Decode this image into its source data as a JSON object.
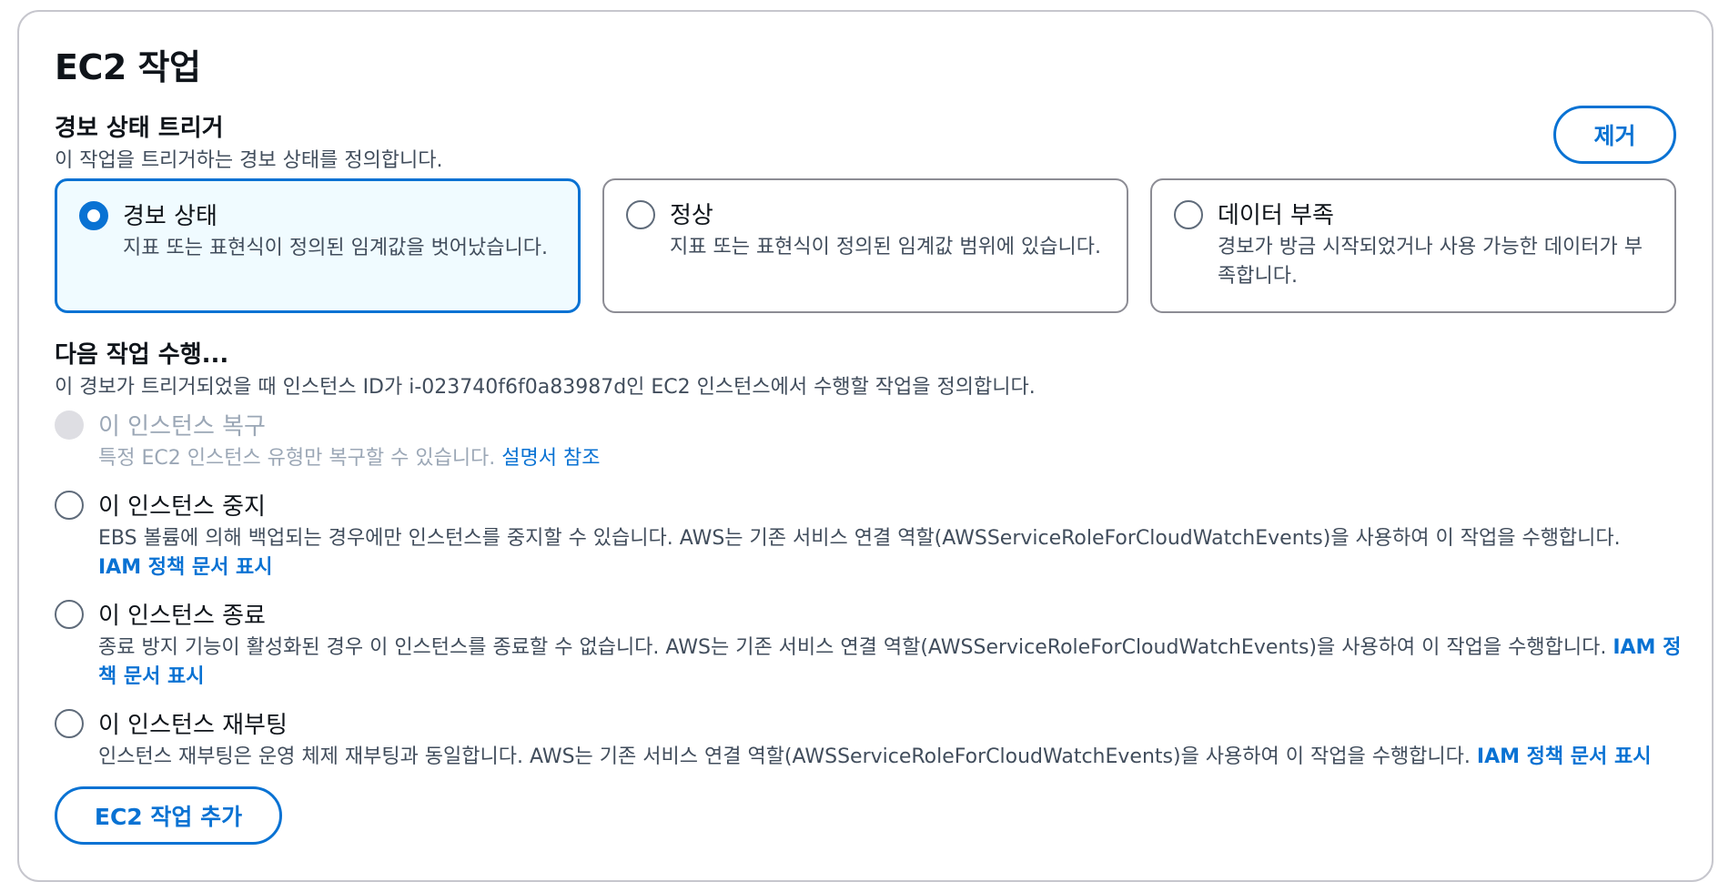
{
  "header": {
    "title": "EC2 작업"
  },
  "remove_button": "제거",
  "trigger": {
    "title": "경보 상태 트리거",
    "description": "이 작업을 트리거하는 경보 상태를 정의합니다.",
    "tiles": [
      {
        "label": "경보 상태",
        "description": "지표 또는 표현식이 정의된 임계값을 벗어났습니다.",
        "selected": true
      },
      {
        "label": "정상",
        "description": "지표 또는 표현식이 정의된 임계값 범위에 있습니다.",
        "selected": false
      },
      {
        "label": "데이터 부족",
        "description": "경보가 방금 시작되었거나 사용 가능한 데이터가 부족합니다.",
        "selected": false
      }
    ]
  },
  "actions": {
    "title": "다음 작업 수행...",
    "description": "이 경보가 트리거되었을 때 인스턴스 ID가 i-023740f6f0a83987d인 EC2 인스턴스에서 수행할 작업을 정의합니다.",
    "options": [
      {
        "label": "이 인스턴스 복구",
        "description": "특정 EC2 인스턴스 유형만 복구할 수 있습니다.",
        "link": "설명서 참조",
        "disabled": true
      },
      {
        "label": "이 인스턴스 중지",
        "description": "EBS 볼륨에 의해 백업되는 경우에만 인스턴스를 중지할 수 있습니다. AWS는 기존 서비스 연결 역할(AWSServiceRoleForCloudWatchEvents)을 사용하여 이 작업을 수행합니다.",
        "link": "IAM 정책 문서 표시",
        "disabled": false
      },
      {
        "label": "이 인스턴스 종료",
        "description": "종료 방지 기능이 활성화된 경우 이 인스턴스를 종료할 수 없습니다. AWS는 기존 서비스 연결 역할(AWSServiceRoleForCloudWatchEvents)을 사용하여 이 작업을 수행합니다.",
        "link": "IAM 정책 문서 표시",
        "disabled": false
      },
      {
        "label": "이 인스턴스 재부팅",
        "description": "인스턴스 재부팅은 운영 체제 재부팅과 동일합니다. AWS는 기존 서비스 연결 역할(AWSServiceRoleForCloudWatchEvents)을 사용하여 이 작업을 수행합니다.",
        "link": "IAM 정책 문서 표시",
        "disabled": false
      }
    ]
  },
  "add_button": "EC2 작업 추가",
  "colors": {
    "accent": "#0972d3",
    "selected_bg": "#f0fbff",
    "disabled": "#9ba7b6"
  }
}
